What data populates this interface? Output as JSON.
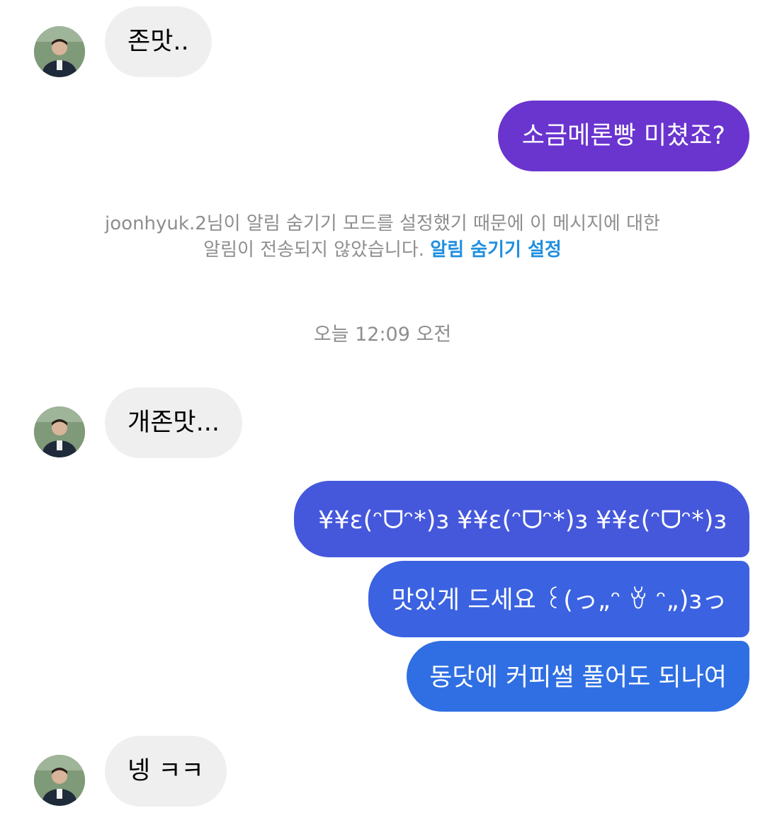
{
  "conversation": {
    "avatar_icon": "user-avatar-photo",
    "messages": [
      {
        "sender": "other",
        "text": "존맛.."
      },
      {
        "sender": "me",
        "text": "소금메론빵 미쳤죠?"
      },
      {
        "sender": "other",
        "text": "개존맛..."
      },
      {
        "sender": "me",
        "text": "¥¥ε(ᵔᗜᵔ*)ɜ ¥¥ε(ᵔᗜᵔ*)ɜ ¥¥ε(ᵔᗜᵔ*)ɜ"
      },
      {
        "sender": "me",
        "text": "맛있게 드세요 ꒰(っ„ᵔ ꈊ ᵔ„)ɜっ"
      },
      {
        "sender": "me",
        "text": "동닷에 커피썰 풀어도 되나여"
      },
      {
        "sender": "other",
        "text": "넹 ㅋㅋ"
      }
    ]
  },
  "notice": {
    "line1": "joonhyuk.2님이 알림 숨기기 모드를 설정했기 때문에 이 메시지에 대한",
    "line2": "알림이 전송되지 않았습니다.",
    "link_label": "알림 숨기기 설정"
  },
  "timestamp": "오늘 12:09 오전",
  "colors": {
    "incoming_bubble": "#efefef",
    "outgoing_purple": "#6a34cf",
    "outgoing_blue_top": "#4558dc",
    "outgoing_blue_bottom": "#2f6fe3",
    "notice_text": "#8e8e8e",
    "link": "#1f8fe0"
  }
}
